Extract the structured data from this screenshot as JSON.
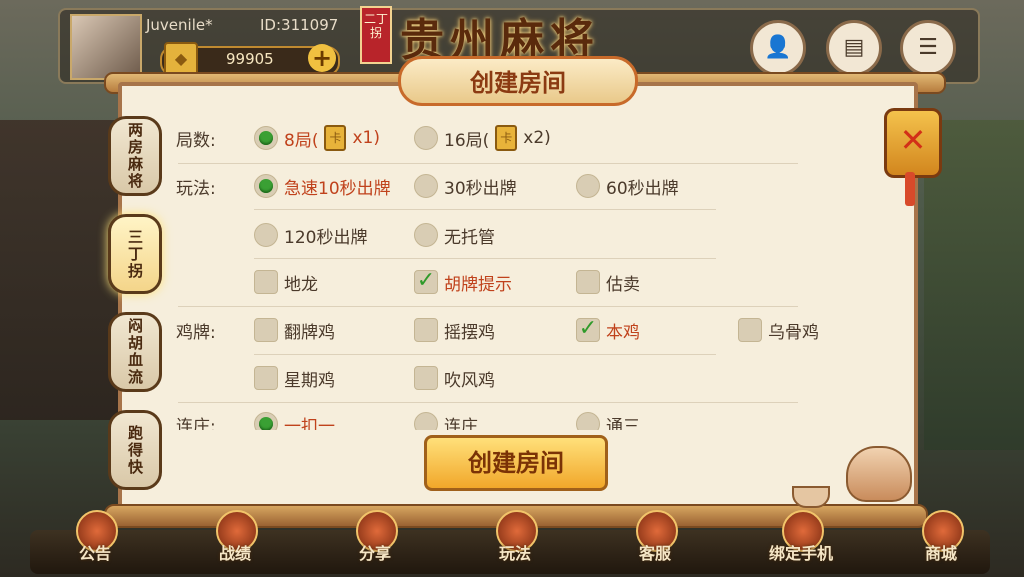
{
  "user": {
    "name": "Juvenile*",
    "id": "ID:311097",
    "coins": "99905",
    "coin_icon": "card-icon",
    "plus": "+"
  },
  "game": {
    "badge": "二丁拐",
    "logo": "贵州麻将"
  },
  "top_icons": [
    "person-icon",
    "id-card-icon",
    "menu-icon"
  ],
  "dialog": {
    "title": "创建房间",
    "close": "✕",
    "create_button": "创建房间"
  },
  "side_tabs": [
    "两房麻将",
    "三丁拐",
    "闷胡血流",
    "跑得快"
  ],
  "rows": {
    "rounds": {
      "label": "局数:",
      "options": [
        {
          "text": "8局(",
          "suffix": "x1)",
          "selected": true
        },
        {
          "text": "16局(",
          "suffix": "x2)",
          "selected": false
        }
      ]
    },
    "play": {
      "label": "玩法:",
      "options": [
        {
          "text": "急速10秒出牌",
          "selected": true
        },
        {
          "text": "30秒出牌",
          "selected": false
        },
        {
          "text": "60秒出牌",
          "selected": false
        },
        {
          "text": "120秒出牌",
          "selected": false
        },
        {
          "text": "无托管",
          "selected": false
        }
      ]
    },
    "extras": [
      {
        "text": "地龙",
        "checked": false
      },
      {
        "text": "胡牌提示",
        "checked": true
      },
      {
        "text": "估卖",
        "checked": false
      }
    ],
    "chicken": {
      "label": "鸡牌:",
      "options": [
        {
          "text": "翻牌鸡",
          "checked": false
        },
        {
          "text": "摇摆鸡",
          "checked": false
        },
        {
          "text": "本鸡",
          "checked": true
        },
        {
          "text": "乌骨鸡",
          "checked": false
        },
        {
          "text": "星期鸡",
          "checked": false
        },
        {
          "text": "吹风鸡",
          "checked": false
        }
      ]
    },
    "lianzhuang": {
      "label": "连庄:",
      "options": [
        {
          "text": "一扣一",
          "selected": true
        },
        {
          "text": "连庄",
          "selected": false
        },
        {
          "text": "通三",
          "selected": false
        }
      ]
    }
  },
  "bottom_nav": [
    "公告",
    "战绩",
    "分享",
    "玩法",
    "客服",
    "绑定手机",
    "商城"
  ],
  "colors": {
    "accent": "#c0421c",
    "selected_dot": "#3aa034",
    "panel_bg": "#f6eedc"
  }
}
